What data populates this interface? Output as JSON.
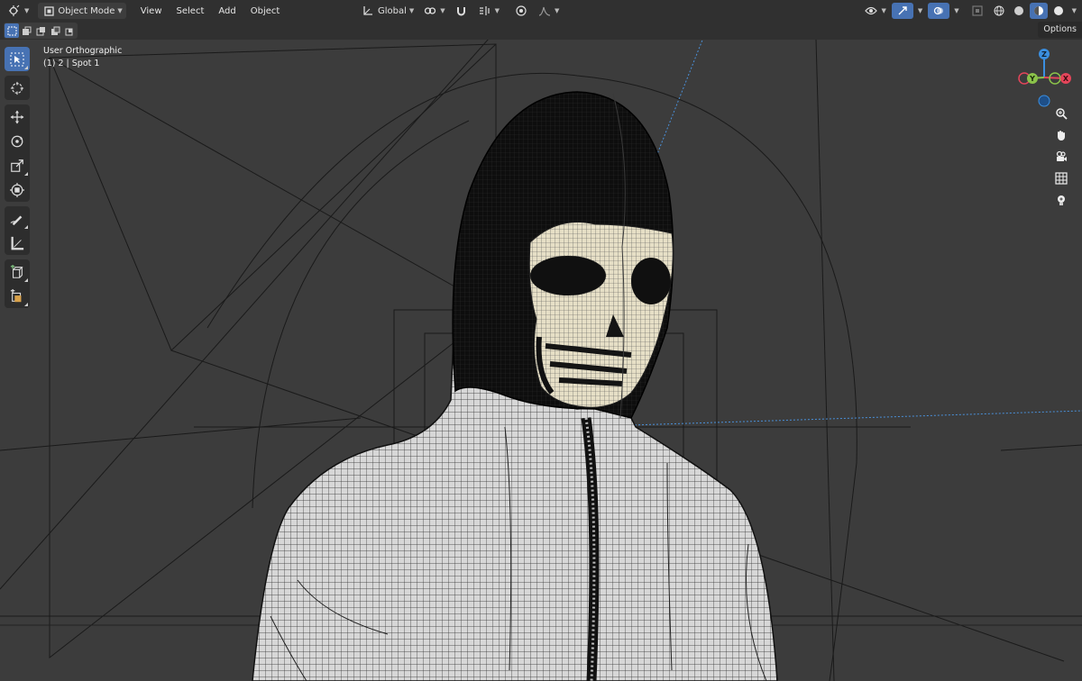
{
  "header": {
    "mode_label": "Object Mode",
    "menu": [
      "View",
      "Select",
      "Add",
      "Object"
    ],
    "transform_orientation": "Global"
  },
  "options_label": "Options",
  "viewport": {
    "view_name": "User Orthographic",
    "context_line": "(1) 2 | Spot 1"
  },
  "gizmo": {
    "z_label": "Z",
    "y_label": "Y",
    "x_label": "X"
  },
  "colors": {
    "accent": "#4772b3",
    "x_axis": "#e4455a",
    "y_axis": "#8bc34a",
    "z_axis": "#3b8fe0"
  },
  "tools": [
    {
      "name": "select-box-tool",
      "icon": "cursor-icon",
      "active": true
    },
    {
      "name": "cursor-tool",
      "icon": "crosshair-icon"
    },
    {
      "name": "move-tool",
      "icon": "move-arrows-icon"
    },
    {
      "name": "rotate-tool",
      "icon": "rotate-icon"
    },
    {
      "name": "scale-tool",
      "icon": "scale-icon"
    },
    {
      "name": "transform-tool",
      "icon": "transform-icon"
    },
    {
      "name": "annotate-tool",
      "icon": "pencil-icon"
    },
    {
      "name": "measure-tool",
      "icon": "ruler-icon"
    },
    {
      "name": "add-cube-tool",
      "icon": "cube-add-icon"
    },
    {
      "name": "add-object-tool",
      "icon": "object-add-icon"
    }
  ],
  "nav_buttons": [
    "zoom-icon",
    "hand-icon",
    "camera-icon",
    "grid-icon",
    "light-icon"
  ]
}
